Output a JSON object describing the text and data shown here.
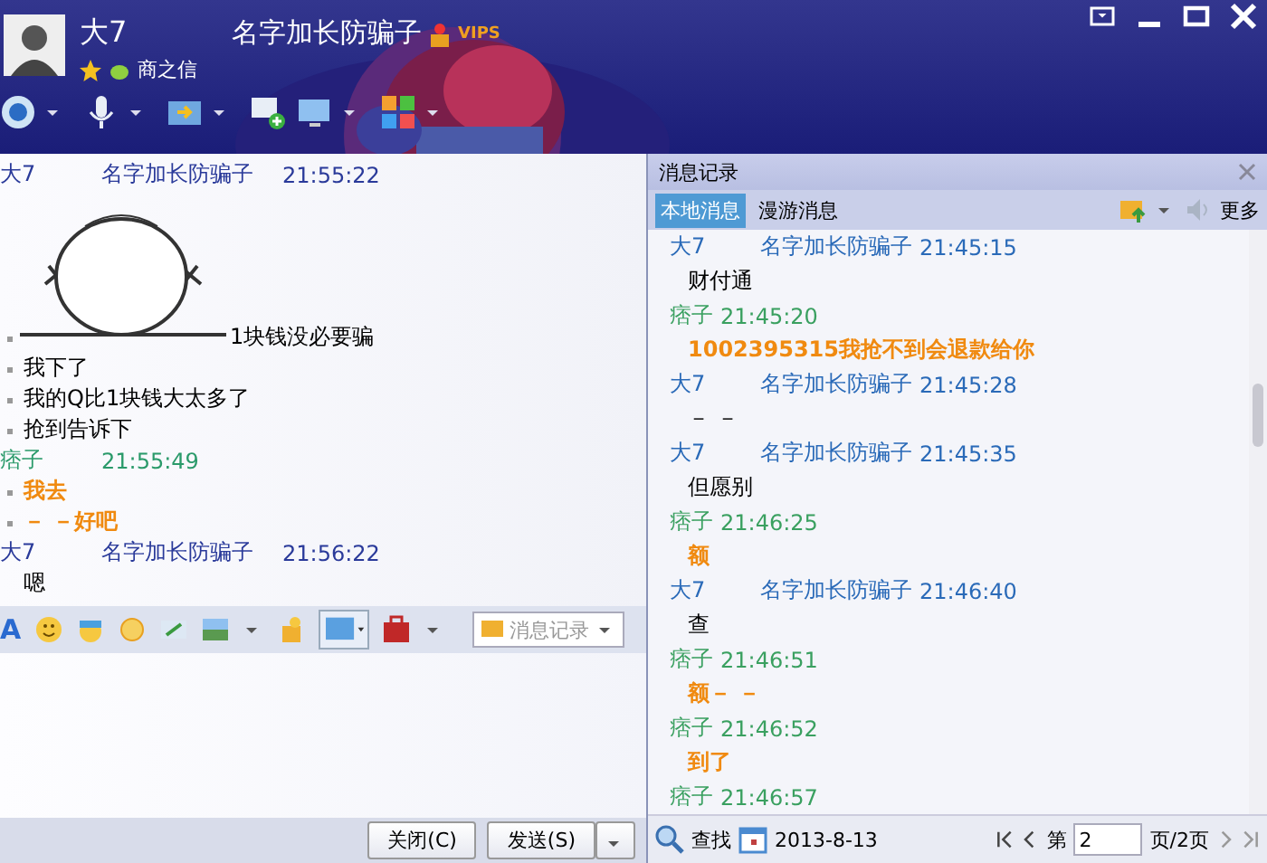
{
  "contact": {
    "name": "大7",
    "nickname": "名字加长防骗子",
    "badge": "VIPS",
    "signature": "商之信"
  },
  "chat": [
    {
      "kind": "self",
      "sender": "大7",
      "nickname": "名字加长防骗子",
      "time": "21:55:22",
      "lines": [
        {
          "kind": "sticker",
          "text": "1块钱没必要骗",
          "bullet": true
        },
        {
          "kind": "text",
          "text": "我下了",
          "bullet": true
        },
        {
          "kind": "text",
          "text": "我的Q比1块钱大太多了",
          "bullet": true
        },
        {
          "kind": "text",
          "text": "抢到告诉下",
          "bullet": true
        }
      ]
    },
    {
      "kind": "other",
      "sender": "痞子",
      "time": "21:55:49",
      "lines": [
        {
          "kind": "text",
          "text": "我去",
          "bullet": true
        },
        {
          "kind": "text",
          "text": "－ －好吧",
          "bullet": true
        }
      ]
    },
    {
      "kind": "self",
      "sender": "大7",
      "nickname": "名字加长防骗子",
      "time": "21:56:22",
      "lines": [
        {
          "kind": "text",
          "text": "嗯",
          "bullet": false
        }
      ]
    }
  ],
  "font_button": "A",
  "history_button": "消息记录",
  "buttons": {
    "close": "关闭(C)",
    "send": "发送(S)"
  },
  "history": {
    "title": "消息记录",
    "tabs": [
      {
        "label": "本地消息",
        "selected": true
      },
      {
        "label": "漫游消息",
        "selected": false
      }
    ],
    "more": "更多",
    "entries": [
      {
        "kind": "self",
        "sender": "大7",
        "nickname": "名字加长防骗子",
        "time": "21:45:15",
        "text": "财付通"
      },
      {
        "kind": "other",
        "sender": "痞子",
        "time": "21:45:20",
        "text": "1002395315我抢不到会退款给你"
      },
      {
        "kind": "self",
        "sender": "大7",
        "nickname": "名字加长防骗子",
        "time": "21:45:28",
        "text": "－ －"
      },
      {
        "kind": "self",
        "sender": "大7",
        "nickname": "名字加长防骗子",
        "time": "21:45:35",
        "text": "但愿别"
      },
      {
        "kind": "other",
        "sender": "痞子",
        "time": "21:46:25",
        "text": "额"
      },
      {
        "kind": "self",
        "sender": "大7",
        "nickname": "名字加长防骗子",
        "time": "21:46:40",
        "text": "查"
      },
      {
        "kind": "other",
        "sender": "痞子",
        "time": "21:46:51",
        "text": "额－ －"
      },
      {
        "kind": "other",
        "sender": "痞子",
        "time": "21:46:52",
        "text": "到了"
      },
      {
        "kind": "other",
        "sender": "痞子",
        "time": "21:46:57"
      }
    ],
    "search": "查找",
    "date": "2013-8-13",
    "page_prefix": "第",
    "page": "2",
    "page_suffix": "页/2页"
  }
}
